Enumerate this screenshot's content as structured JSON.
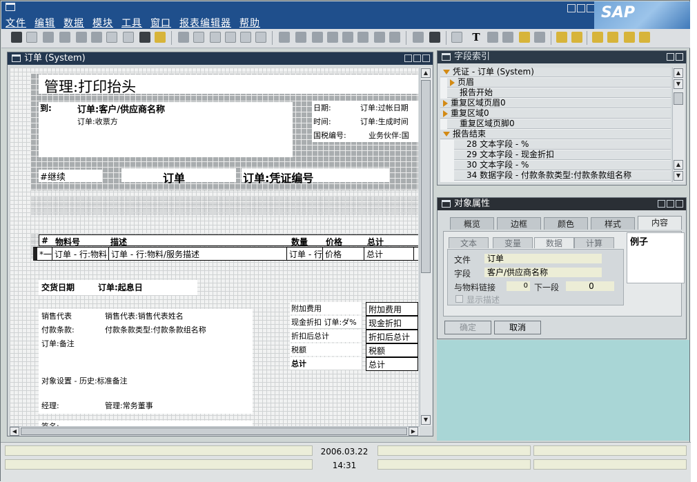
{
  "menu": {
    "items": [
      "文件",
      "编辑",
      "数据",
      "模块",
      "工具",
      "窗口",
      "报表编辑器",
      "帮助"
    ]
  },
  "logo": {
    "text": "SAP"
  },
  "report_window": {
    "title": "订单 (System)",
    "header": {
      "title": "管理:打印抬头",
      "to_label": "到:",
      "to_value": "订单:客户/供应商名称",
      "payee": "订单:收票方",
      "date_label": "日期:",
      "date_value": "订单:过帐日期",
      "time_label": "时间:",
      "time_value": "订单:生成时间",
      "tax_label": "国税编号:",
      "tax_value": "业务伙伴:国",
      "continue": "#继续",
      "doc_title": "订单",
      "doc_number": "订单:凭证编号"
    },
    "table": {
      "headers": [
        "#",
        "物料号",
        "描述",
        "数量",
        "价格",
        "总计"
      ],
      "row": [
        "*一",
        "订单 - 行:物料",
        "订单 - 行:物料/服务描述",
        "订单 - 行",
        "价格",
        "总计"
      ]
    },
    "footer": {
      "delivery_label": "交货日期",
      "delivery_value": "订单:起息日",
      "sales_label": "销售代表",
      "sales_value": "销售代表:销售代表姓名",
      "terms_label": "付款条款:",
      "terms_value": "付款条款类型:付款条款组名称",
      "remarks": "订单:备注",
      "object_settings": "对象设置 - 历史:标准备注",
      "manager_label": "经理:",
      "manager_value": "管理:常务董事",
      "signature_label": "签名:",
      "totals": [
        {
          "label": "附加费用",
          "value": "附加费用"
        },
        {
          "label": "现金折扣 订单:ダ%",
          "value": "现金折扣"
        },
        {
          "label": "折扣后总计",
          "value": "折扣后总计"
        },
        {
          "label": "税额",
          "value": "税额"
        },
        {
          "label": "总计",
          "value": "总计"
        }
      ]
    }
  },
  "field_index": {
    "title": "字段索引",
    "items": [
      {
        "label": "凭证 - 订单 (System)",
        "state": "open",
        "indent": 0
      },
      {
        "label": "页眉",
        "state": "closed",
        "indent": 1
      },
      {
        "label": "报告开始",
        "state": "none",
        "indent": 1
      },
      {
        "label": "重复区域页眉0",
        "state": "closed",
        "indent": 0
      },
      {
        "label": "重复区域0",
        "state": "closed",
        "indent": 0
      },
      {
        "label": "重复区域页脚0",
        "state": "none",
        "indent": 1
      },
      {
        "label": "报告结束",
        "state": "open",
        "indent": 0
      },
      {
        "label": "28 文本字段 - %",
        "state": "none",
        "indent": 2
      },
      {
        "label": "29 文本字段 - 现金折扣",
        "state": "none",
        "indent": 2
      },
      {
        "label": "30 文本字段 - %",
        "state": "none",
        "indent": 2
      },
      {
        "label": "34 数据字段 - 付款条款类型:付款条款组名称",
        "state": "none",
        "indent": 2
      }
    ]
  },
  "properties": {
    "title": "对象属性",
    "tabs": [
      "概览",
      "边框",
      "颜色",
      "样式",
      "内容"
    ],
    "active_tab": "内容",
    "subtabs": [
      "文本",
      "变量",
      "数据",
      "计算"
    ],
    "active_subtab": "数据",
    "example_label": "例子",
    "file_label": "文件",
    "file_value": "订单",
    "field_label": "字段",
    "field_value": "客户/供应商名称",
    "link_label": "与物料链接",
    "link_value": "0",
    "next_label": "下一段",
    "next_value": "0",
    "show_desc": "显示描述",
    "ok": "确定",
    "cancel": "取消"
  },
  "status": {
    "date": "2006.03.22",
    "time": "14:31"
  }
}
